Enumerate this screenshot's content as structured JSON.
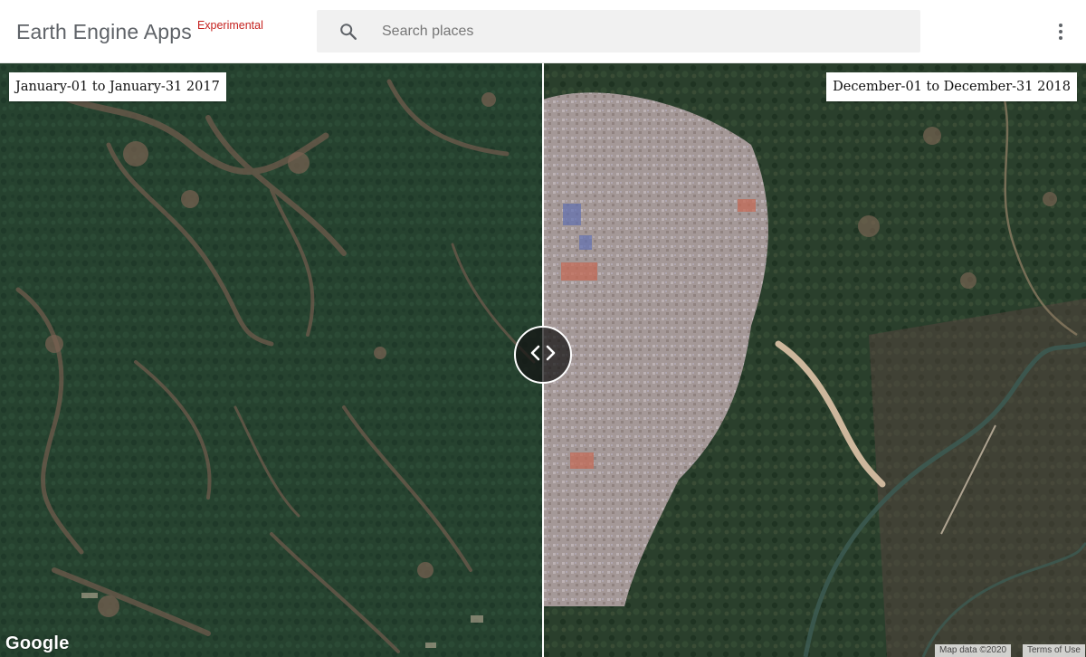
{
  "app": {
    "title": "Earth Engine Apps",
    "badge": "Experimental"
  },
  "search": {
    "placeholder": "Search places",
    "value": ""
  },
  "map": {
    "left_date_label": "January-01 to January-31 2017",
    "right_date_label": "December-01 to December-31 2018",
    "google_logo_text": "Google",
    "attribution": "Map data ©2020",
    "terms": "Terms of Use",
    "colors": {
      "forest": "#23402e",
      "bare_soil": "#8a6a58",
      "camp_settlement": "#b2a6a8"
    }
  },
  "icons": {
    "search": "search-icon",
    "menu": "more-vert-icon",
    "split_handle": "code-arrows-icon"
  }
}
